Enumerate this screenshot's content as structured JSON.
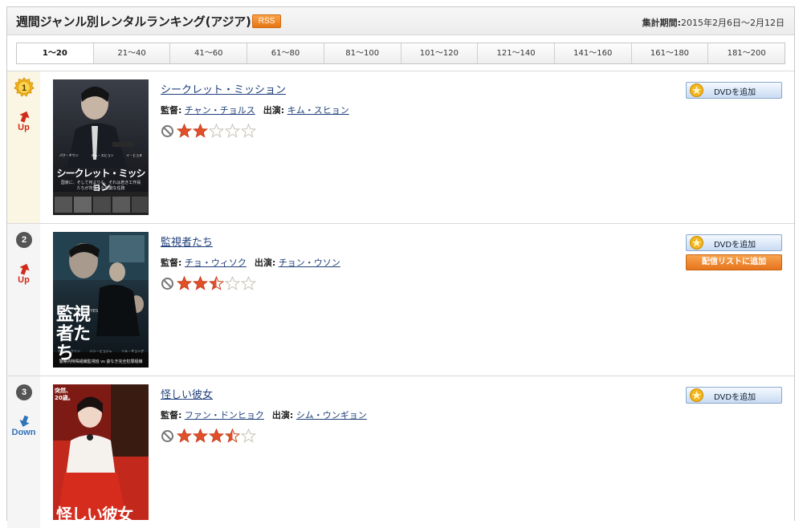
{
  "header": {
    "title": "週間ジャンル別レンタルランキング(アジア)",
    "rss_label": "RSS",
    "period_label": "集計期間:",
    "period_value": "2015年2月6日～2月12日"
  },
  "tabs": [
    "1～20",
    "21～40",
    "41～60",
    "61～80",
    "81～100",
    "101～120",
    "121～140",
    "141～160",
    "161～180",
    "181～200"
  ],
  "active_tab": "1～20",
  "labels": {
    "director": "監督:",
    "cast": "出演:",
    "add_dvd": "DVDを追加",
    "add_stream": "配信リストに追加"
  },
  "items": [
    {
      "rank": "1",
      "trend": "Up",
      "title": "シークレット・ミッション",
      "director": "チャン・チョルス",
      "cast": "キム・スヒョン",
      "rating": 2,
      "poster_text": "シークレット・ミッション",
      "poster_sub": "国家に、そして何よりも、それは若き工作員たちが背負った悲劇な任務",
      "poster_cast": [
        "パク・ギウン",
        "キム・スヒョン",
        "イ・ヒョヌ"
      ],
      "has_stream": false
    },
    {
      "rank": "2",
      "trend": "Up",
      "title": "監視者たち",
      "director": "チョ・ウィソク",
      "cast": "チョン・ウソン",
      "rating": 2.5,
      "poster_text": "監視者たち",
      "poster_sub": "COLD EYES",
      "poster_cast": [
        "チョン・ウソン",
        "ハン・ヒョジュ",
        "ソル・ギョング"
      ],
      "poster_bottom": "警察内特殊組織監視班 vs 姿なき完全犯罪組織",
      "has_stream": true
    },
    {
      "rank": "3",
      "trend": "Down",
      "title": "怪しい彼女",
      "director": "ファン・ドンヒョク",
      "cast": "シム・ウンギョン",
      "rating": 3.5,
      "poster_text": "怪しい彼女",
      "poster_sub": "突然、20歳。",
      "has_stream": false
    }
  ],
  "colors": {
    "title_link": "#1f3f7a",
    "star_fill": "#e2502a",
    "up": "#d12a1a",
    "down": "#2f73b8",
    "rss": "#e57614"
  }
}
